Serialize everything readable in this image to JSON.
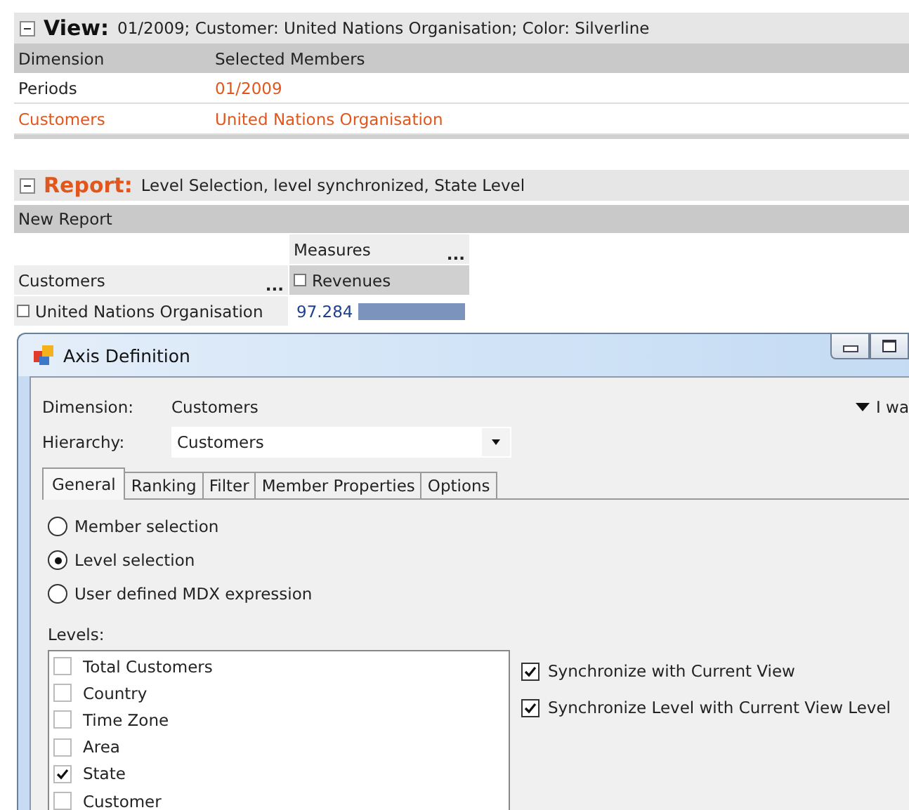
{
  "view": {
    "expanded": true,
    "title": "View:",
    "summary": "01/2009; Customer: United Nations Organisation; Color: Silverline",
    "columns": [
      "Dimension",
      "Selected Members"
    ],
    "rows": [
      {
        "dimension": "Periods",
        "members": "01/2009",
        "highlighted": false
      },
      {
        "dimension": "Customers",
        "members": "United Nations Organisation",
        "highlighted": true
      }
    ]
  },
  "report": {
    "expanded": true,
    "title": "Report:",
    "summary": "Level Selection, level synchronized, State Level",
    "name": "New Report",
    "pivot": {
      "measures_label": "Measures",
      "measures_more": "...",
      "rows_label": "Customers",
      "rows_more": "...",
      "measure": "Revenues",
      "member": "United Nations Organisation",
      "value": "97.284"
    }
  },
  "dialog": {
    "title": "Axis Definition",
    "dimension_label": "Dimension:",
    "dimension": "Customers",
    "hint": "I wa",
    "hierarchy_label": "Hierarchy:",
    "hierarchy": "Customers",
    "tabs": [
      {
        "label": "General",
        "selected": true
      },
      {
        "label": "Ranking",
        "selected": false
      },
      {
        "label": "Filter",
        "selected": false
      },
      {
        "label": "Member Properties",
        "selected": false
      },
      {
        "label": "Options",
        "selected": false
      }
    ],
    "modes": [
      {
        "label": "Member selection",
        "selected": false
      },
      {
        "label": "Level selection",
        "selected": true
      },
      {
        "label": "User defined MDX expression",
        "selected": false
      }
    ],
    "levels_label": "Levels:",
    "levels": [
      {
        "label": "Total Customers",
        "checked": false
      },
      {
        "label": "Country",
        "checked": false
      },
      {
        "label": "Time Zone",
        "checked": false
      },
      {
        "label": "Area",
        "checked": false
      },
      {
        "label": "State",
        "checked": true
      },
      {
        "label": "Customer",
        "checked": false
      }
    ],
    "options": [
      {
        "label": "Synchronize with Current View",
        "checked": true
      },
      {
        "label": "Synchronize Level with Current View Level",
        "checked": true
      }
    ]
  }
}
